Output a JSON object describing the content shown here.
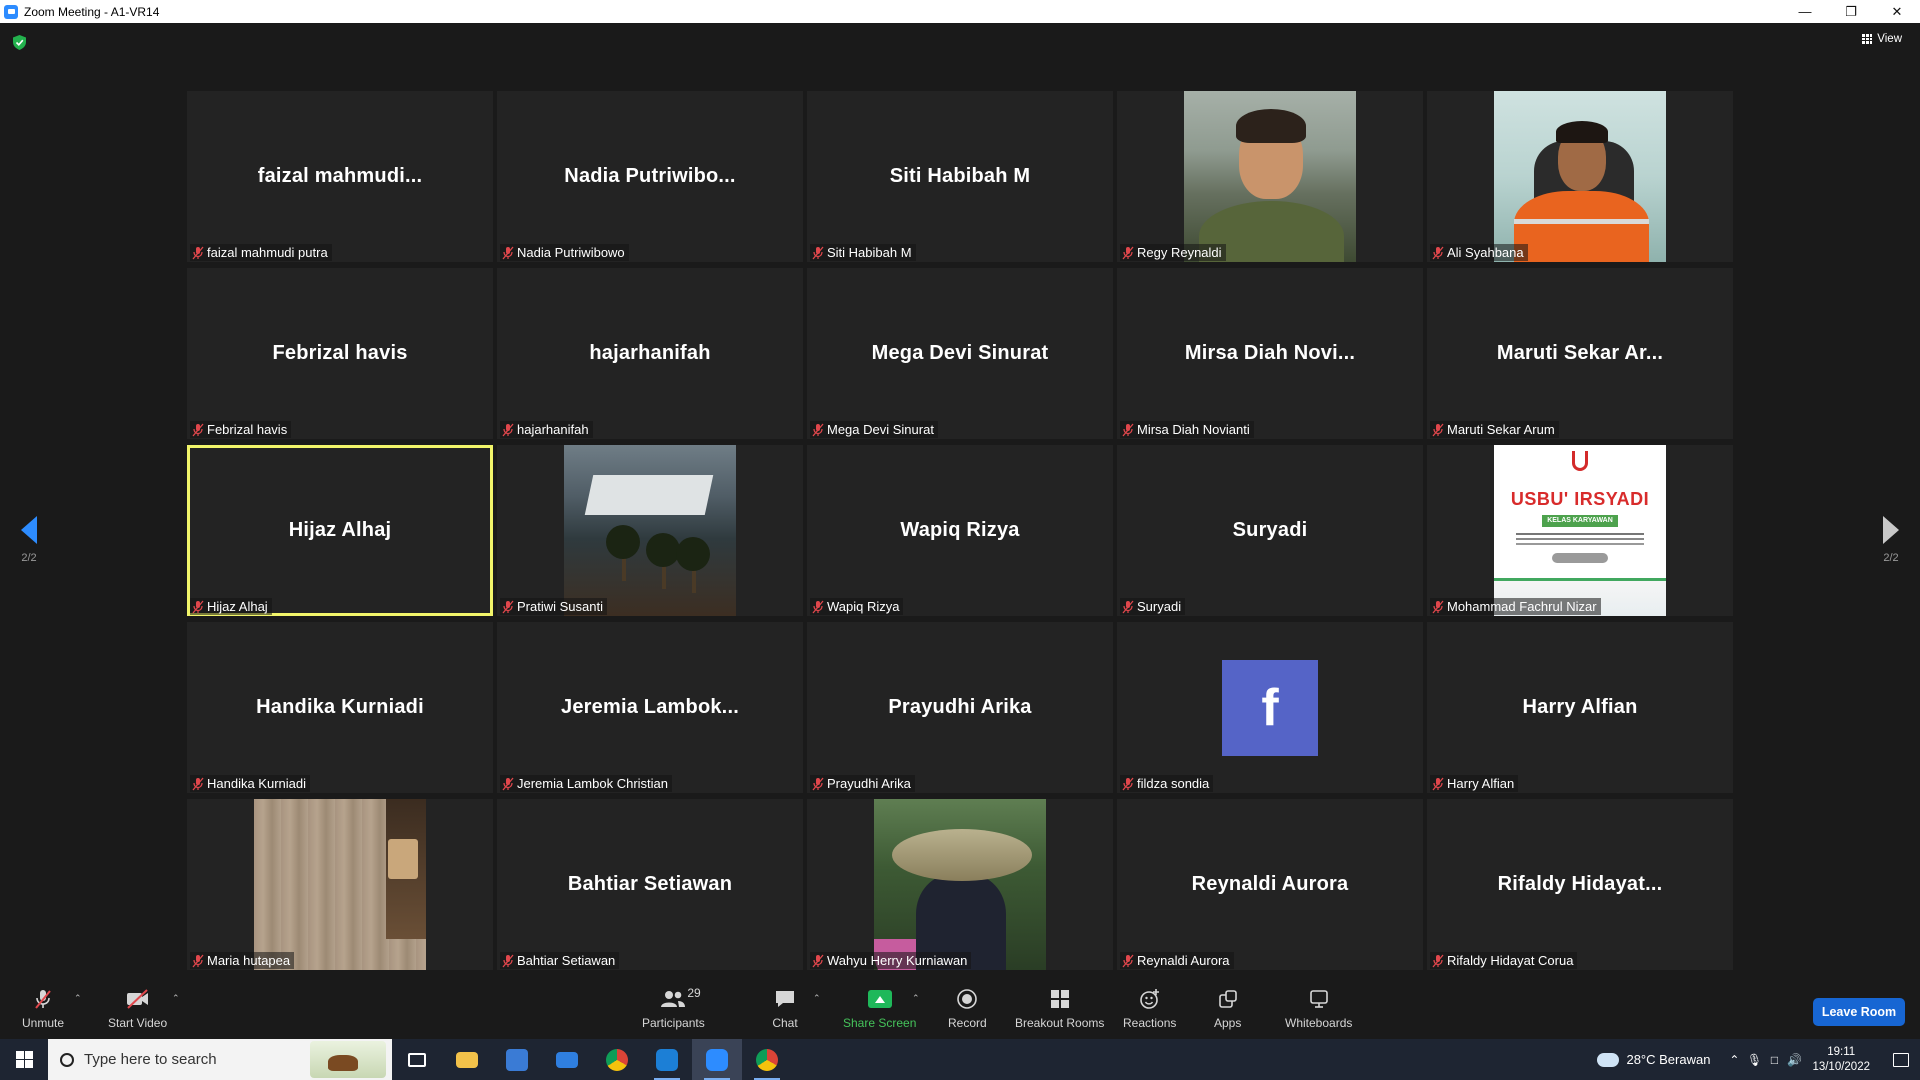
{
  "window": {
    "title": "Zoom Meeting - A1-VR14",
    "controls": [
      "—",
      "❐",
      "✕"
    ]
  },
  "view": {
    "label": "View"
  },
  "pager": {
    "left": "2/2",
    "right": "2/2"
  },
  "tiles": [
    {
      "name": "faizal mahmudi putra",
      "display": "faizal  mahmudi...",
      "type": "name"
    },
    {
      "name": "Nadia Putriwibowo",
      "display": "Nadia  Putriwibo...",
      "type": "name"
    },
    {
      "name": "Siti Habibah M",
      "display": "Siti Habibah M",
      "type": "name"
    },
    {
      "name": "Regy Reynaldi",
      "display": "",
      "type": "photo-regy"
    },
    {
      "name": "Ali Syahbana",
      "display": "",
      "type": "photo-ali"
    },
    {
      "name": "Febrizal havis",
      "display": "Febrizal havis",
      "type": "name"
    },
    {
      "name": "hajarhanifah",
      "display": "hajarhanifah",
      "type": "name"
    },
    {
      "name": "Mega Devi Sinurat",
      "display": "Mega Devi Sinurat",
      "type": "name"
    },
    {
      "name": "Mirsa Diah Novianti",
      "display": "Mirsa  Diah  Novi...",
      "type": "name"
    },
    {
      "name": "Maruti Sekar Arum",
      "display": "Maruti  Sekar  Ar...",
      "type": "name"
    },
    {
      "name": "Hijaz Alhaj",
      "display": "Hijaz Alhaj",
      "type": "name",
      "active": true
    },
    {
      "name": "Pratiwi Susanti",
      "display": "",
      "type": "photo-villa"
    },
    {
      "name": "Wapiq Rizya",
      "display": "Wapiq Rizya",
      "type": "name"
    },
    {
      "name": "Suryadi",
      "display": "Suryadi",
      "type": "name"
    },
    {
      "name": "Mohammad Fachrul Nizar",
      "display": "",
      "type": "photo-usb"
    },
    {
      "name": "Handika Kurniadi",
      "display": "Handika Kurniadi",
      "type": "name"
    },
    {
      "name": "Jeremia Lambok Christian",
      "display": "Jeremia  Lambok...",
      "type": "name"
    },
    {
      "name": "Prayudhi Arika",
      "display": "Prayudhi Arika",
      "type": "name"
    },
    {
      "name": "fildza sondia",
      "display": "",
      "type": "photo-fb"
    },
    {
      "name": "Harry Alfian",
      "display": "Harry Alfian",
      "type": "name"
    },
    {
      "name": "Maria hutapea",
      "display": "",
      "type": "photo-floor"
    },
    {
      "name": "Bahtiar Setiawan",
      "display": "Bahtiar Setiawan",
      "type": "name"
    },
    {
      "name": "Wahyu Herry Kurniawan",
      "display": "",
      "type": "photo-fish"
    },
    {
      "name": "Reynaldi Aurora",
      "display": "Reynaldi Aurora",
      "type": "name"
    },
    {
      "name": "Rifaldy Hidayat Corua",
      "display": "Rifaldy  Hidayat...",
      "type": "name"
    }
  ],
  "usb_poster": {
    "title": "USBU' IRSYADI",
    "badge": "KELAS KARYAWAN"
  },
  "fb_letter": "f",
  "toolbar": {
    "unmute": "Unmute",
    "start_video": "Start Video",
    "participants": "Participants",
    "participants_count": "29",
    "chat": "Chat",
    "share_screen": "Share Screen",
    "record": "Record",
    "breakout_rooms": "Breakout Rooms",
    "reactions": "Reactions",
    "apps": "Apps",
    "whiteboards": "Whiteboards",
    "leave": "Leave Room"
  },
  "taskbar": {
    "search_placeholder": "Type here to search",
    "weather": "28°C  Berawan",
    "time": "19:11",
    "date": "13/10/2022"
  },
  "colors": {
    "accent": "#2d8cff",
    "active_speaker": "#f2f56a",
    "share_green": "#1fb85a",
    "leave_blue": "#1766d3",
    "mute_red": "#e0474c"
  }
}
